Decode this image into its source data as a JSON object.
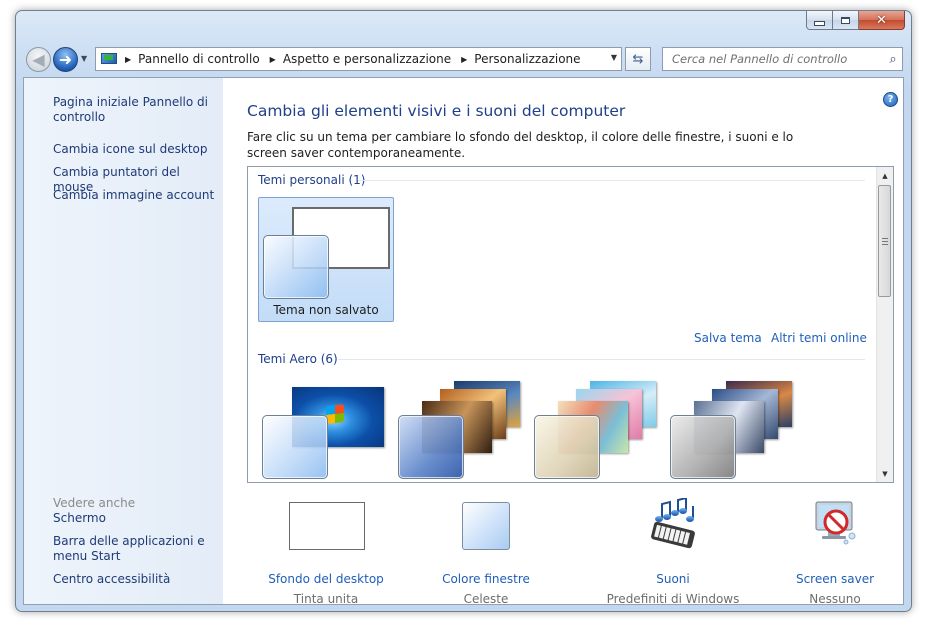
{
  "window": {
    "caption": {
      "minimize": "–",
      "close": "✕"
    }
  },
  "nav": {
    "back_icon": "arrow-left-icon",
    "forward_icon": "arrow-right-icon",
    "breadcrumbs": [
      "Pannello di controllo",
      "Aspetto e personalizzazione",
      "Personalizzazione"
    ],
    "search_placeholder": "Cerca nel Pannello di controllo"
  },
  "sidebar": {
    "links": [
      "Pagina iniziale Pannello di controllo",
      "Cambia icone sul desktop",
      "Cambia puntatori del mouse",
      "Cambia immagine account"
    ],
    "see_also_heading": "Vedere anche",
    "see_also": [
      "Schermo",
      "Barra delle applicazioni e menu Start",
      "Centro accessibilità"
    ]
  },
  "main": {
    "title": "Cambia gli elementi visivi e i suoni del computer",
    "description": "Fare clic su un tema per cambiare lo sfondo del desktop, il colore delle finestre, i suoni e lo screen saver contemporaneamente.",
    "my_themes_header": "Temi personali (1)",
    "unsaved_theme_label": "Tema non salvato",
    "save_theme_link": "Salva tema",
    "more_themes_link": "Altri temi online",
    "aero_header": "Temi Aero (6)"
  },
  "bottom": [
    {
      "link": "Sfondo del desktop",
      "sub": "Tinta unita"
    },
    {
      "link": "Colore finestre",
      "sub": "Celeste"
    },
    {
      "link": "Suoni",
      "sub": "Predefiniti di Windows"
    },
    {
      "link": "Screen saver",
      "sub": "Nessuno"
    }
  ],
  "colors": {
    "link": "#1f5fb8",
    "title": "#1e3f8a",
    "sidebar_link": "#1f3a78",
    "close_button": "#c44c2f"
  }
}
